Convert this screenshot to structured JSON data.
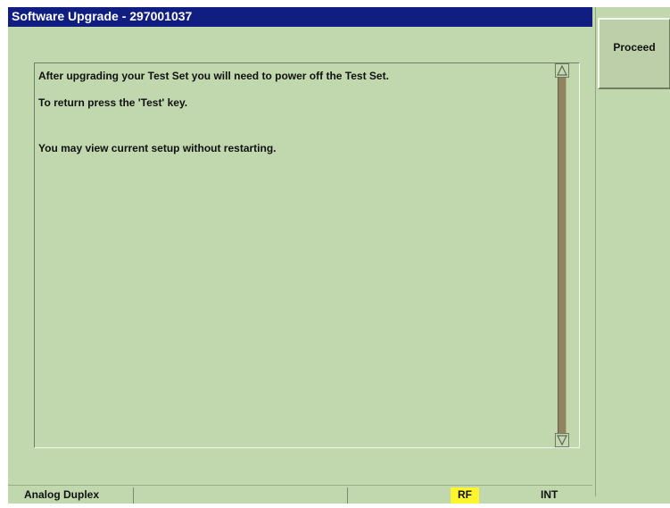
{
  "window": {
    "title": "Software Upgrade - 297001037"
  },
  "softkeys": [
    {
      "label": "Proceed"
    }
  ],
  "message": {
    "lines": [
      "After upgrading your Test Set you will need to power off the Test Set.",
      "To return press the 'Test' key.",
      "You may view current setup without restarting."
    ]
  },
  "status_bar": {
    "mode": "Analog Duplex",
    "rf": "RF",
    "int": "INT"
  },
  "colors": {
    "background": "#c1d8ae",
    "title_bar": "#0f1e80",
    "rf_highlight": "#fff52e",
    "scroll_track": "#8e8462"
  },
  "icons": {
    "scroll_up": "scroll-up-arrow-icon",
    "scroll_down": "scroll-down-arrow-icon"
  }
}
